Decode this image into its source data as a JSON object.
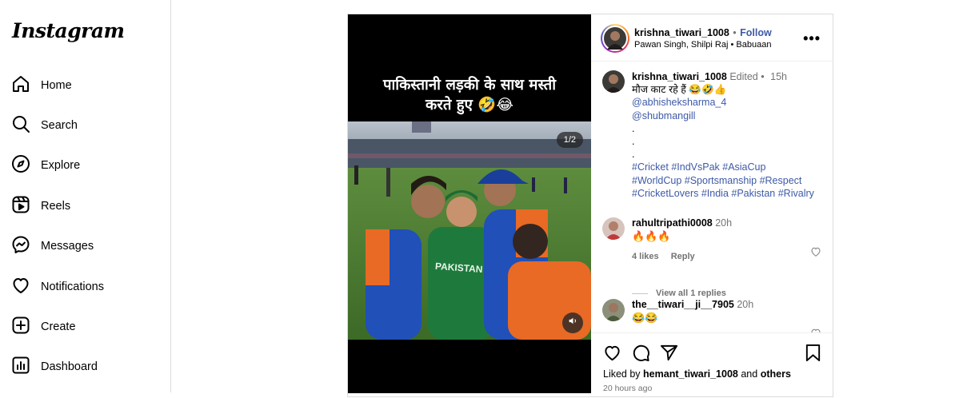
{
  "sidebar": {
    "logo": "Instagram",
    "items": [
      {
        "label": "Home",
        "icon": "home-icon"
      },
      {
        "label": "Search",
        "icon": "search-icon"
      },
      {
        "label": "Explore",
        "icon": "compass-icon"
      },
      {
        "label": "Reels",
        "icon": "reels-icon"
      },
      {
        "label": "Messages",
        "icon": "messenger-icon"
      },
      {
        "label": "Notifications",
        "icon": "heart-icon"
      },
      {
        "label": "Create",
        "icon": "plus-square-icon"
      },
      {
        "label": "Dashboard",
        "icon": "dashboard-icon"
      }
    ]
  },
  "post": {
    "media": {
      "overlay_line1": "पाकिस्तानी  लड़की के साथ मस्ती",
      "overlay_line2": "करते हुए 🤣😂",
      "page_indicator": "1/2",
      "jersey_text": "PAKISTAN"
    },
    "header": {
      "username": "krishna_tiwari_1008",
      "separator": "•",
      "follow": "Follow",
      "audio": "Pawan Singh, Shilpi Raj",
      "audio_sep": "•",
      "audio_track": "Babuaan"
    },
    "caption": {
      "username": "krishna_tiwari_1008",
      "edited": "Edited",
      "dot": "•",
      "time": "15h",
      "text": "मौज काट  रहे हैं 😂🤣👍",
      "mention1": "@abhisheksharma_4",
      "mention2": "@shubmangill",
      "dot1": ".",
      "dot2": ".",
      "dot3": ".",
      "tags_line1": "#Cricket #IndVsPak #AsiaCup",
      "tags_line2": "#WorldCup #Sportsmanship #Respect",
      "tags_line3": "#CricketLovers #India #Pakistan #Rivalry"
    },
    "comments": [
      {
        "username": "rahultripathi0008",
        "time": "20h",
        "text": "🔥🔥🔥",
        "likes": "4 likes",
        "reply": "Reply",
        "view_replies": "View all 1 replies"
      },
      {
        "username": "the__tiwari__ji__7905",
        "time": "20h",
        "text": "😂😂"
      }
    ],
    "footer": {
      "liked_by_prefix": "Liked by",
      "liked_by_user": "hemant_tiwari_1008",
      "liked_by_and": "and",
      "liked_by_others": "others",
      "timestamp": "20 hours ago"
    }
  }
}
